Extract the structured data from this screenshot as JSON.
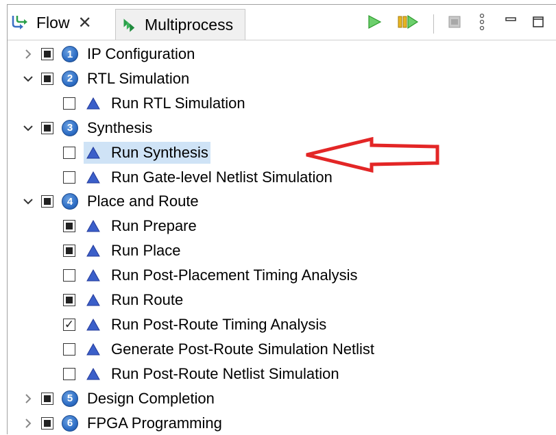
{
  "tabs": {
    "flow_label": "Flow",
    "multiprocess_label": "Multiprocess"
  },
  "colors": {
    "selection": "#cfe3f6",
    "run_green": "#2bb04a",
    "annotation_red": "#e32626",
    "step_blue": "#2f6fc6"
  },
  "tree": {
    "groups": [
      {
        "num": "1",
        "label": "IP Configuration",
        "expanded": false,
        "check": "partial"
      },
      {
        "num": "2",
        "label": "RTL Simulation",
        "expanded": true,
        "check": "partial",
        "children": [
          {
            "label": "Run RTL Simulation",
            "check": "unchecked"
          }
        ]
      },
      {
        "num": "3",
        "label": "Synthesis",
        "expanded": true,
        "check": "partial",
        "children": [
          {
            "label": "Run Synthesis",
            "check": "unchecked",
            "selected": true
          },
          {
            "label": "Run Gate-level Netlist Simulation",
            "check": "unchecked"
          }
        ]
      },
      {
        "num": "4",
        "label": "Place and Route",
        "expanded": true,
        "check": "partial",
        "children": [
          {
            "label": "Run Prepare",
            "check": "partial"
          },
          {
            "label": "Run Place",
            "check": "partial"
          },
          {
            "label": "Run Post-Placement Timing Analysis",
            "check": "unchecked"
          },
          {
            "label": "Run Route",
            "check": "partial"
          },
          {
            "label": "Run Post-Route Timing Analysis",
            "check": "checked"
          },
          {
            "label": "Generate Post-Route Simulation Netlist",
            "check": "unchecked"
          },
          {
            "label": "Run Post-Route Netlist Simulation",
            "check": "unchecked"
          }
        ]
      },
      {
        "num": "5",
        "label": "Design Completion",
        "expanded": false,
        "check": "partial"
      },
      {
        "num": "6",
        "label": "FPGA Programming",
        "expanded": false,
        "check": "partial"
      }
    ]
  }
}
